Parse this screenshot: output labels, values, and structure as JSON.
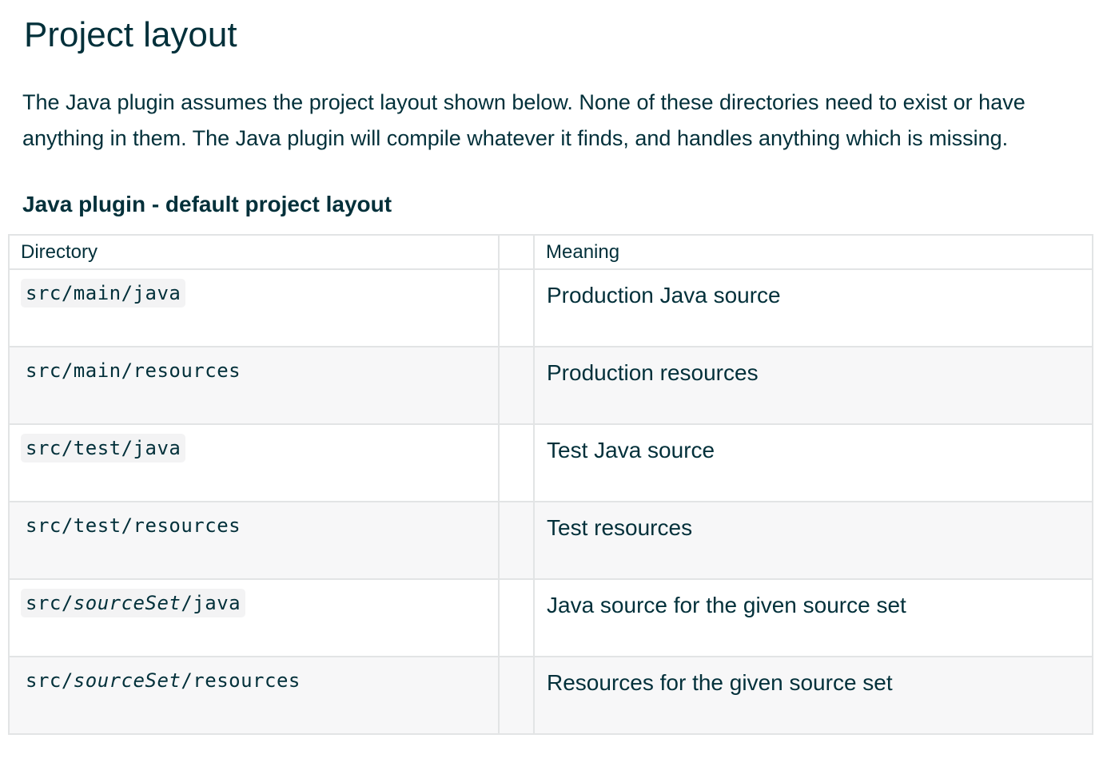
{
  "page": {
    "title": "Project layout",
    "intro": "The Java plugin assumes the project layout shown below. None of these directories need to exist or have anything in them. The Java plugin will compile whatever it finds, and handles anything which is missing.",
    "table_caption": "Java plugin - default project layout"
  },
  "table": {
    "headers": {
      "directory": "Directory",
      "spacer": "",
      "meaning": "Meaning"
    },
    "rows": [
      {
        "dir_prefix": "src/",
        "dir_var": "",
        "dir_path": "main/java",
        "meaning": "Production Java source"
      },
      {
        "dir_prefix": "src/",
        "dir_var": "",
        "dir_path": "main/resources",
        "meaning": "Production resources"
      },
      {
        "dir_prefix": "src/",
        "dir_var": "",
        "dir_path": "test/java",
        "meaning": "Test Java source"
      },
      {
        "dir_prefix": "src/",
        "dir_var": "",
        "dir_path": "test/resources",
        "meaning": "Test resources"
      },
      {
        "dir_prefix": "src/",
        "dir_var": "sourceSet",
        "dir_path": "/java",
        "meaning": "Java source for the given source set"
      },
      {
        "dir_prefix": "src/",
        "dir_var": "sourceSet",
        "dir_path": "/resources",
        "meaning": "Resources for the given source set"
      }
    ]
  }
}
